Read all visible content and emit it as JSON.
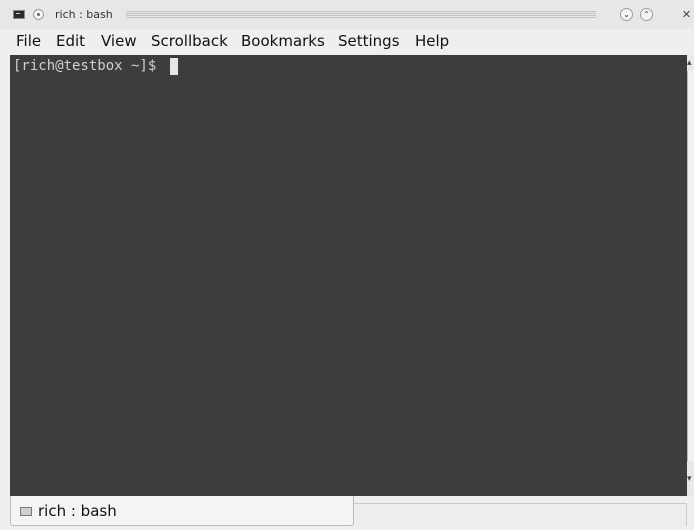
{
  "window": {
    "title": "rich : bash",
    "app_icon": "terminal-icon",
    "menu_icon": "circle-dot-icon",
    "controls": {
      "minimize_icon": "chevron-down-icon",
      "maximize_icon": "chevron-up-icon",
      "close_icon": "close-icon",
      "minimize_glyph": "⌄",
      "maximize_glyph": "⌃",
      "close_glyph": "✕"
    }
  },
  "menubar": {
    "items": [
      "File",
      "Edit",
      "View",
      "Scrollback",
      "Bookmarks",
      "Settings",
      "Help"
    ]
  },
  "terminal": {
    "prompt": "[rich@testbox ~]$ ",
    "background": "#3d3d3d",
    "foreground": "#d0d0d0"
  },
  "tabs": [
    {
      "label": "rich : bash",
      "icon": "terminal-tab-icon",
      "active": true
    }
  ]
}
